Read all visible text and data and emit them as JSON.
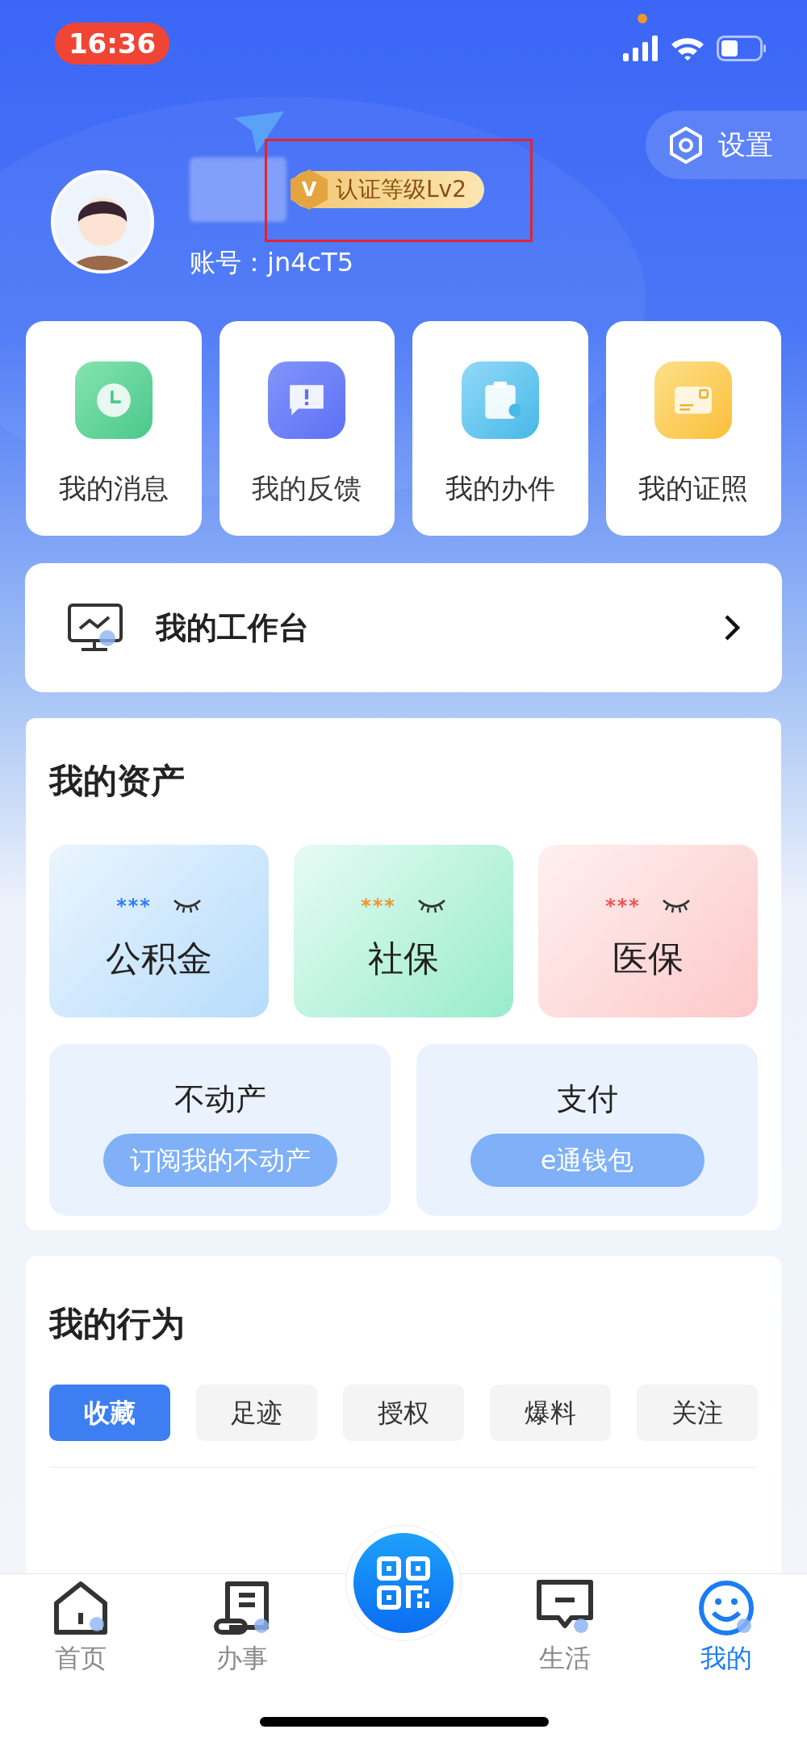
{
  "status_bar": {
    "time": "16:36"
  },
  "settings": {
    "label": "设置"
  },
  "profile": {
    "badge_icon": "V",
    "badge": "认证等级Lv2",
    "account": "账号：jn4cT5"
  },
  "quick_links": [
    {
      "kind": "clock",
      "label": "我的消息"
    },
    {
      "kind": "message",
      "label": "我的反馈"
    },
    {
      "kind": "clipboard",
      "label": "我的办件"
    },
    {
      "kind": "card",
      "label": "我的证照"
    }
  ],
  "workbench": {
    "label": "我的工作台"
  },
  "assets": {
    "title": "我的资产",
    "cards": [
      {
        "kind": "fund",
        "mask": "***",
        "color": "#2f7cf6",
        "label": "公积金"
      },
      {
        "kind": "social",
        "mask": "***",
        "color": "#f0962a",
        "label": "社保"
      },
      {
        "kind": "medical",
        "mask": "***",
        "color": "#f05454",
        "label": "医保"
      }
    ],
    "wide_cards": [
      {
        "title": "不动产",
        "action": "订阅我的不动产"
      },
      {
        "title": "支付",
        "action": "e通钱包"
      }
    ]
  },
  "behavior": {
    "title": "我的行为",
    "tabs": [
      {
        "label": "收藏",
        "selected": true
      },
      {
        "label": "足迹",
        "selected": false
      },
      {
        "label": "授权",
        "selected": false
      },
      {
        "label": "爆料",
        "selected": false
      },
      {
        "label": "关注",
        "selected": false
      }
    ]
  },
  "nav": [
    {
      "kind": "home",
      "label": "首页",
      "selected": false
    },
    {
      "kind": "tasks",
      "label": "办事",
      "selected": false
    },
    {
      "kind": "scan"
    },
    {
      "kind": "life",
      "label": "生活",
      "selected": false
    },
    {
      "kind": "mine",
      "label": "我的",
      "selected": true
    }
  ]
}
